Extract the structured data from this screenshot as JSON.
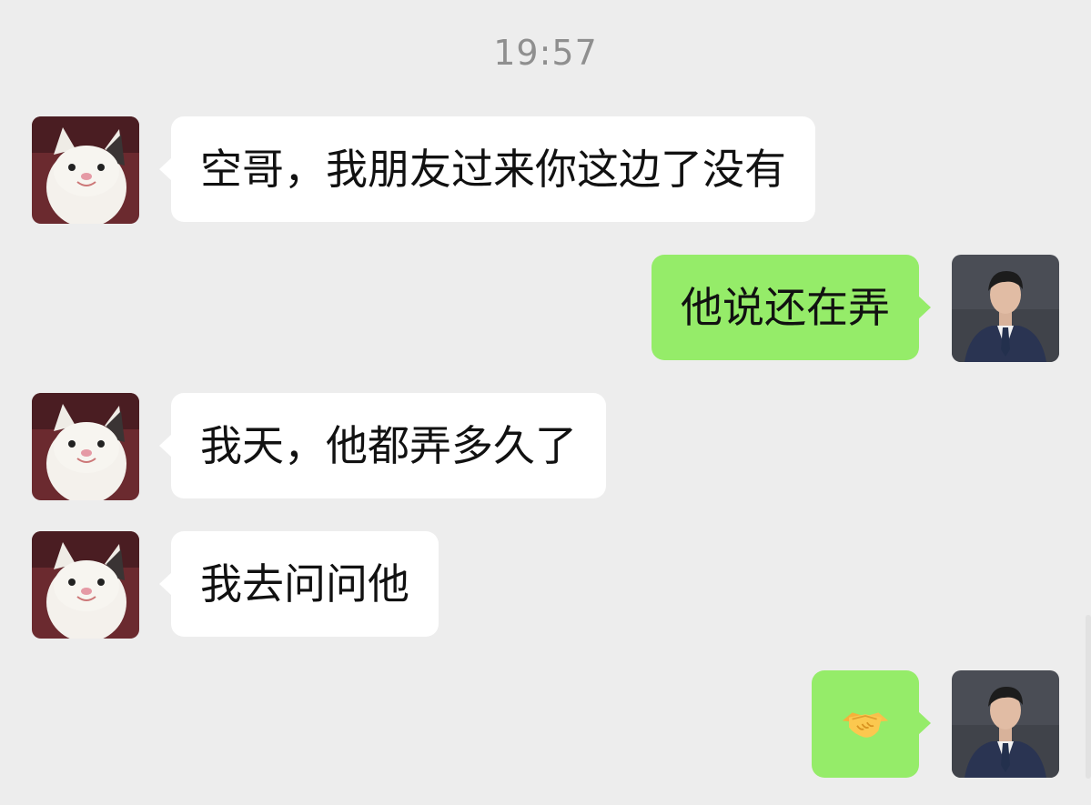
{
  "chat": {
    "timestamp": "19:57",
    "messages": [
      {
        "sender": "friend",
        "avatar": "cat-avatar",
        "text": "空哥，我朋友过来你这边了没有"
      },
      {
        "sender": "me",
        "avatar": "man-in-suit-avatar",
        "text": "他说还在弄"
      },
      {
        "sender": "friend",
        "avatar": "cat-avatar",
        "text": "我天，他都弄多久了"
      },
      {
        "sender": "friend",
        "avatar": "cat-avatar",
        "text": "我去问问他"
      },
      {
        "sender": "me",
        "avatar": "man-in-suit-avatar",
        "text": "",
        "emoji": "handshake-emoji"
      }
    ]
  },
  "colors": {
    "background": "#ededed",
    "incoming_bubble": "#ffffff",
    "outgoing_bubble": "#95ec69",
    "timestamp_text": "#8f8f8f"
  }
}
